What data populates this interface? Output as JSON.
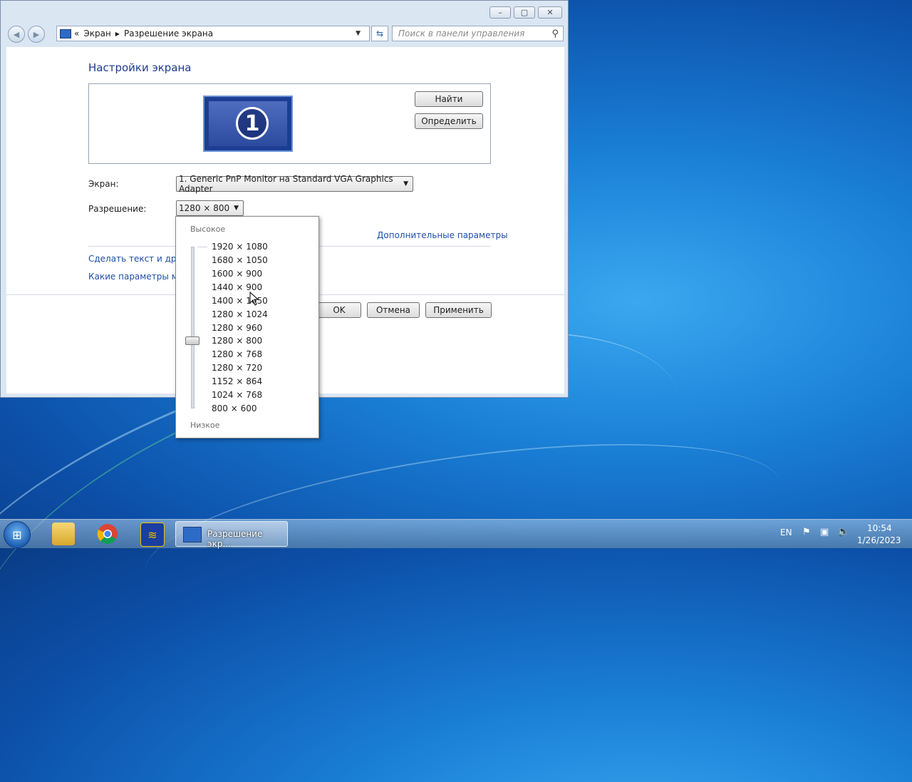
{
  "address": {
    "crumb1": "Экран",
    "crumb2": "Разрешение экрана"
  },
  "search": {
    "placeholder": "Поиск в панели управления"
  },
  "window": {
    "controls": [
      "–",
      "▢",
      "✕"
    ]
  },
  "page_title": "Настройки экрана",
  "buttons": {
    "find": "Найти",
    "identify": "Определить",
    "ok": "OK",
    "cancel": "Отмена",
    "apply": "Применить"
  },
  "form": {
    "screen_label": "Экран:",
    "screen_value": "1. Generic PnP Monitor на Standard VGA Graphics Adapter",
    "resolution_label": "Разрешение:",
    "resolution_value": "1280 × 800"
  },
  "monitor_number": "1",
  "links": {
    "advanced": "Дополнительные параметры",
    "text_size": "Сделать текст и други",
    "which_params": "Какие параметры мон"
  },
  "dropdown": {
    "high": "Высокое",
    "low": "Низкое",
    "options": [
      "1920 × 1080",
      "1680 × 1050",
      "1600 × 900",
      "1440 × 900",
      "1400 × 1050",
      "1280 × 1024",
      "1280 × 960",
      "1280 × 800",
      "1280 × 768",
      "1280 × 720",
      "1152 × 864",
      "1024 × 768",
      "800 × 600"
    ],
    "selected": "1280 × 800"
  },
  "taskbar": {
    "task_title": "Разрешение экр...",
    "lang": "EN",
    "time": "10:54",
    "date": "1/26/2023"
  },
  "colors": {
    "link": "#1e4fa8",
    "title": "#1e3b8a"
  }
}
